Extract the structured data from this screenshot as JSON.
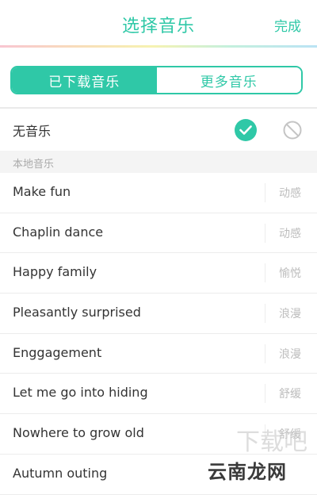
{
  "header": {
    "title": "选择音乐",
    "done_label": "完成"
  },
  "segmented": {
    "tabs": [
      {
        "label": "已下载音乐",
        "active": true
      },
      {
        "label": "更多音乐",
        "active": false
      }
    ]
  },
  "no_music": {
    "label": "无音乐",
    "selected": true
  },
  "section": {
    "title": "本地音乐"
  },
  "tracks": [
    {
      "name": "Make fun",
      "tag": "动感"
    },
    {
      "name": "Chaplin dance",
      "tag": "动感"
    },
    {
      "name": "Happy family",
      "tag": "愉悦"
    },
    {
      "name": "Pleasantly surprised",
      "tag": "浪漫"
    },
    {
      "name": "Enggagement",
      "tag": "浪漫"
    },
    {
      "name": "Let me go into hiding",
      "tag": "舒缓"
    },
    {
      "name": "Nowhere to grow old",
      "tag": "舒缓"
    },
    {
      "name": "Autumn outing",
      "tag": ""
    }
  ],
  "watermark": {
    "text": "云南龙网",
    "faint_text": "下载吧"
  },
  "colors": {
    "accent": "#2fc8a7"
  }
}
